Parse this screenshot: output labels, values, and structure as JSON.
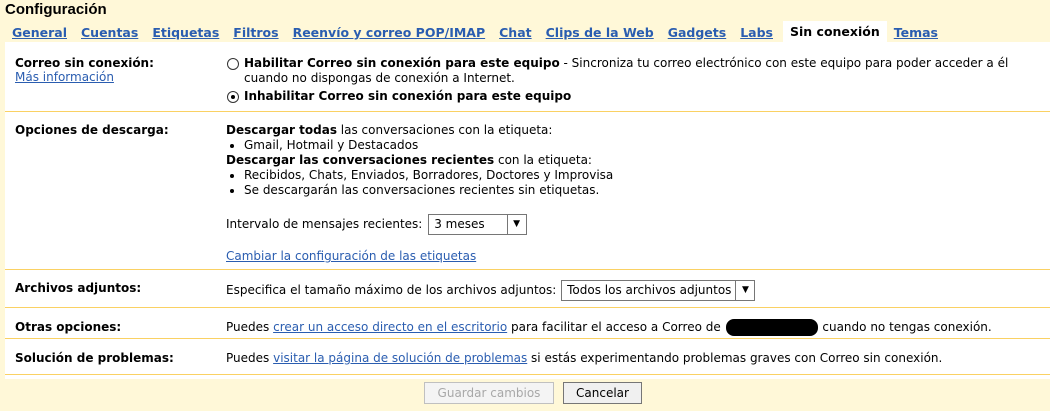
{
  "header": {
    "title": "Configuración"
  },
  "tabs": [
    {
      "label": "General"
    },
    {
      "label": "Cuentas"
    },
    {
      "label": "Etiquetas"
    },
    {
      "label": "Filtros"
    },
    {
      "label": "Reenvío y correo POP/IMAP"
    },
    {
      "label": "Chat"
    },
    {
      "label": "Clips de la Web"
    },
    {
      "label": "Gadgets"
    },
    {
      "label": "Labs"
    },
    {
      "label": "Sin conexión",
      "active": true
    },
    {
      "label": "Temas"
    }
  ],
  "offline": {
    "label": "Correo sin conexión:",
    "more_info": "Más información",
    "enable_label": "Habilitar Correo sin conexión para este equipo",
    "enable_desc": " - Sincroniza tu correo electrónico con este equipo para poder acceder a él cuando no dispongas de conexión a Internet.",
    "disable_label": "Inhabilitar Correo sin conexión para este equipo",
    "selected": "disable"
  },
  "download": {
    "label": "Opciones de descarga:",
    "all_bold": "Descargar todas",
    "all_rest": " las conversaciones con la etiqueta:",
    "all_items": [
      "Gmail, Hotmail y Destacados"
    ],
    "recent_bold": "Descargar las conversaciones recientes",
    "recent_rest": " con la etiqueta:",
    "recent_items": [
      "Recibidos, Chats, Enviados, Borradores, Doctores y Improvisa",
      "Se descargarán las conversaciones recientes sin etiquetas."
    ],
    "interval_label": "Intervalo de mensajes recientes:",
    "interval_value": "3 meses",
    "change_link": "Cambiar la configuración de las etiquetas"
  },
  "attachments": {
    "label": "Archivos adjuntos:",
    "desc": "Especifica el tamaño máximo de los archivos adjuntos:",
    "value": "Todos los archivos adjuntos"
  },
  "other": {
    "label": "Otras opciones:",
    "pre": "Puedes ",
    "link": "crear un acceso directo en el escritorio",
    "mid": " para facilitar el acceso a Correo de ",
    "post": " cuando no tengas conexión."
  },
  "troubleshoot": {
    "label": "Solución de problemas:",
    "pre": "Puedes ",
    "link": "visitar la página de solución de problemas",
    "post": " si estás experimentando problemas graves con Correo sin conexión."
  },
  "footer": {
    "save": "Guardar cambios",
    "cancel": "Cancelar"
  },
  "colors": {
    "accent": "#2a5db0",
    "background": "#fff8d8",
    "border": "#fad163"
  }
}
